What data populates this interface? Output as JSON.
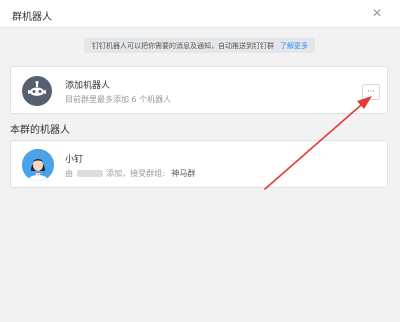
{
  "dialog": {
    "title": "群机器人",
    "close_icon": "close-icon"
  },
  "notice": {
    "text": "钉钉机器人可以把你需要的消息及通知，自动推送到钉钉群",
    "link": "了解更多"
  },
  "add_robot": {
    "title": "添加机器人",
    "subtitle": "目前群里最多添加 6 个机器人",
    "more_button": "···",
    "icon": "robot-icon"
  },
  "section": {
    "title": "本群的机器人"
  },
  "robots": [
    {
      "name": "小钉",
      "by_prefix": "由",
      "added_text": "添加，接受群组:",
      "group": "神马群",
      "avatar": "person-avatar-icon"
    }
  ],
  "colors": {
    "accent_link": "#3a86ff",
    "annotation_arrow": "#e53935",
    "robot_icon_bg": "#56606e",
    "avatar_bg": "#4aa3e8"
  }
}
